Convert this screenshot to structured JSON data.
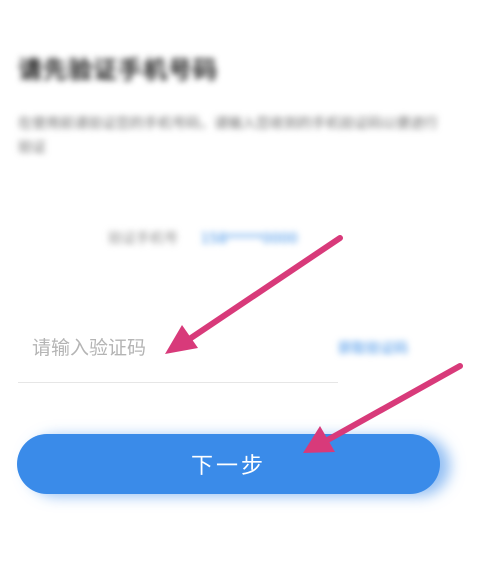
{
  "header": {
    "title": "请先验证手机号码",
    "description": "在使用前请验证您的手机号码，请输入您收到的手机验证码以便进行验证"
  },
  "phone": {
    "label": "验证手机号",
    "link": "158*****0000"
  },
  "code_input": {
    "placeholder": "请输入验证码",
    "value": ""
  },
  "resend": {
    "label": "获取验证码"
  },
  "next_button": {
    "label": "下一步"
  },
  "colors": {
    "accent": "#3a8be9",
    "arrow": "#d83a7a"
  }
}
